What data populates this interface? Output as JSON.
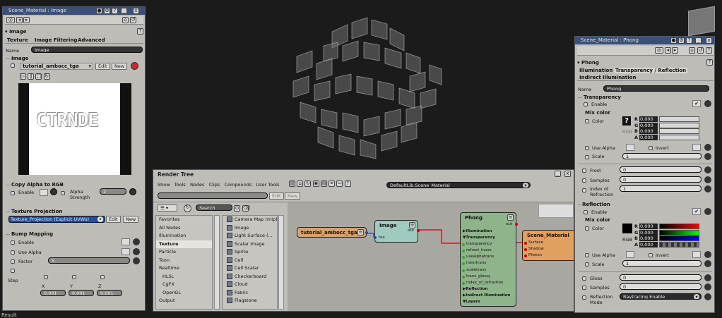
{
  "left_panel": {
    "title": "Scene_Material : Image",
    "section": "Image",
    "tabs": [
      "Texture",
      "Image Filtering",
      "Advanced"
    ],
    "name_label": "Name",
    "name_value": "Image",
    "image_group": "Image",
    "clip_name": "tutorial_ambocc_tga",
    "edit": "Edit",
    "new": "New",
    "image_text": "CTRNDE",
    "copy_alpha": "Copy Alpha to RGB",
    "enable": "Enable",
    "alpha_strength": "Alpha Strength",
    "alpha_strength_value": "2",
    "tex_proj": "Texture Projection",
    "tex_proj_value": "Texture_Projection (Explicit UVWs)",
    "bump": "Bump Mapping",
    "bump_enable": "Enable",
    "use_alpha": "Use Alpha",
    "factor": "Factor",
    "factor_value": "5",
    "step": "Step",
    "x": "X",
    "y": "Y",
    "z": "Z",
    "step_x": "0,001",
    "step_y": "0,001",
    "step_z": "0,001"
  },
  "status": "Result",
  "render_tree": {
    "title": "Render Tree",
    "menu": [
      "Show",
      "Tools",
      "Nodes",
      "Clips",
      "Compounds",
      "User Tools"
    ],
    "edit": "Edit",
    "new": "New",
    "material": "DefaultLib.Scene_Material",
    "search_placeholder": "Search",
    "categories": [
      "Favorites",
      "All Nodes",
      "Illumination",
      "Texture",
      "Particle",
      "Toon",
      "Realtime",
      "HLSL",
      "CgFX",
      "OpenGL",
      "Output"
    ],
    "selected_category": "Texture",
    "nodes_list": [
      "Camera Map (mip)",
      "Image",
      "Light Surface (...",
      "Scalar Image",
      "Sprite",
      "Cell",
      "Cell Scalar",
      "Checkerboard",
      "Cloud",
      "Fabric",
      "Flagstone"
    ],
    "graph": {
      "tga_node": "tutorial_ambocc_tga",
      "image_node": "Image",
      "image_out": "out",
      "image_in": "tex",
      "phong_node": "Phong",
      "phong_out": "out",
      "phong_ports": [
        "▶Illumination",
        "▼Transparency",
        "transparency",
        "refract_inuse",
        "usealphatrans",
        "invertrans",
        "scaletrans",
        "trans_glossy",
        "index_of_refraction",
        "▶Reflection",
        "▶Indirect Illumination",
        "▼Layers"
      ],
      "scene_node": "Scene_Material",
      "scene_ports": [
        "Surface",
        "Shadow",
        "Photon"
      ]
    }
  },
  "right_panel": {
    "title": "Scene_Material : Phong",
    "section": "Phong",
    "tabs": [
      "Illumination",
      "Transparency / Reflection",
      "Indirect Illumination"
    ],
    "name_label": "Name",
    "name_value": "Phong",
    "transparency": "Transparency",
    "enable": "Enable",
    "mix_color": "Mix color",
    "color": "Color",
    "rgb": "RGB",
    "r": "R",
    "g": "G",
    "b": "B",
    "a": "A",
    "zero": "0,000",
    "use_alpha": "Use Alpha",
    "invert": "Invert",
    "scale": "Scale",
    "scale_value": "1",
    "frost": "Frost",
    "frost_value": "0",
    "samples": "Samples",
    "samples_value": "0",
    "ior": "Index of Refraction",
    "ior_value": "1",
    "reflection": "Reflection",
    "refl_enable": "Enable",
    "mix_color2": "Mix color",
    "color2": "Color",
    "scale2_value": "1",
    "gloss": "Gloss",
    "gloss_value": "0",
    "samples2": "Samples",
    "samples2_value": "0",
    "refl_mode": "Reflection Mode",
    "refl_mode_value": "Raytracing Enable"
  }
}
